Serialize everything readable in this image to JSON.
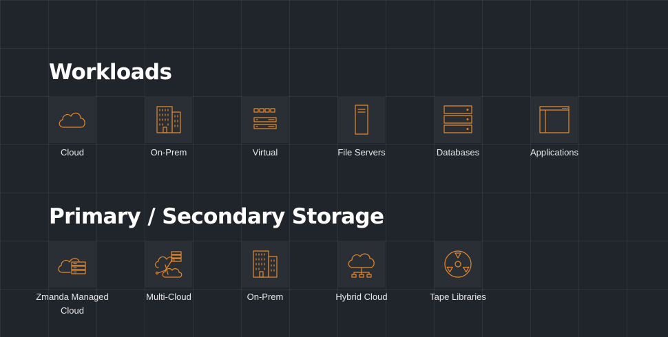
{
  "workloads": {
    "title": "Workloads",
    "items": [
      {
        "label": "Cloud",
        "icon": "cloud-icon"
      },
      {
        "label": "On-Prem",
        "icon": "building-icon"
      },
      {
        "label": "Virtual",
        "icon": "virtual-server-icon"
      },
      {
        "label": "File Servers",
        "icon": "file-server-icon"
      },
      {
        "label": "Databases",
        "icon": "database-stack-icon"
      },
      {
        "label": "Applications",
        "icon": "application-window-icon"
      }
    ]
  },
  "storage": {
    "title": "Primary / Secondary Storage",
    "items": [
      {
        "label": "Zmanda Managed Cloud",
        "icon": "managed-cloud-icon"
      },
      {
        "label": "Multi-Cloud",
        "icon": "multi-cloud-icon"
      },
      {
        "label": "On-Prem",
        "icon": "building-icon"
      },
      {
        "label": "Hybrid Cloud",
        "icon": "hybrid-cloud-icon"
      },
      {
        "label": "Tape Libraries",
        "icon": "tape-reel-icon"
      }
    ]
  },
  "colors": {
    "background": "#20242b",
    "tile": "#2a2e35",
    "accent": "#e58a2d",
    "text": "#ffffff"
  }
}
